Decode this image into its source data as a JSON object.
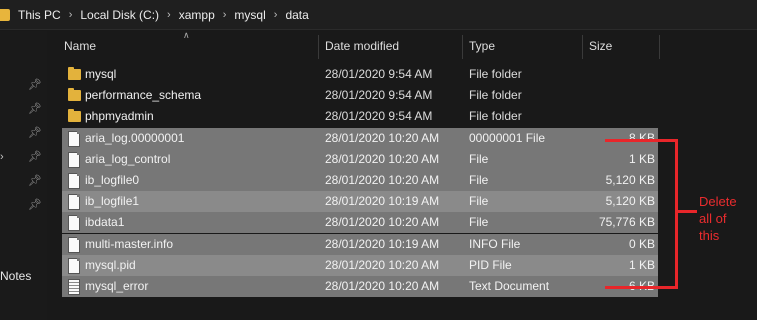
{
  "breadcrumb": {
    "segments": [
      "This PC",
      "Local Disk (C:)",
      "xampp",
      "mysql",
      "data"
    ]
  },
  "sidebar": {
    "partial_label": "Notes"
  },
  "columns": {
    "name": "Name",
    "date": "Date modified",
    "type": "Type",
    "size": "Size"
  },
  "files": [
    {
      "name": "mysql",
      "date": "28/01/2020 9:54 AM",
      "type": "File folder",
      "size": "",
      "icon": "folder-icon",
      "selected": false
    },
    {
      "name": "performance_schema",
      "date": "28/01/2020 9:54 AM",
      "type": "File folder",
      "size": "",
      "icon": "folder-icon",
      "selected": false
    },
    {
      "name": "phpmyadmin",
      "date": "28/01/2020 9:54 AM",
      "type": "File folder",
      "size": "",
      "icon": "folder-icon",
      "selected": false
    },
    {
      "name": "aria_log.00000001",
      "date": "28/01/2020 10:20 AM",
      "type": "00000001 File",
      "size": "8 KB",
      "icon": "file-icon",
      "selected": true
    },
    {
      "name": "aria_log_control",
      "date": "28/01/2020 10:20 AM",
      "type": "File",
      "size": "1 KB",
      "icon": "file-icon",
      "selected": true
    },
    {
      "name": "ib_logfile0",
      "date": "28/01/2020 10:20 AM",
      "type": "File",
      "size": "5,120 KB",
      "icon": "file-icon",
      "selected": true
    },
    {
      "name": "ib_logfile1",
      "date": "28/01/2020 10:19 AM",
      "type": "File",
      "size": "5,120 KB",
      "icon": "file-icon",
      "selected": true
    },
    {
      "name": "ibdata1",
      "date": "28/01/2020 10:20 AM",
      "type": "File",
      "size": "75,776 KB",
      "icon": "file-icon",
      "selected": true
    },
    {
      "name": "multi-master.info",
      "date": "28/01/2020 10:19 AM",
      "type": "INFO File",
      "size": "0 KB",
      "icon": "file-icon",
      "selected": true
    },
    {
      "name": "mysql.pid",
      "date": "28/01/2020 10:20 AM",
      "type": "PID File",
      "size": "1 KB",
      "icon": "file-icon",
      "selected": true
    },
    {
      "name": "mysql_error",
      "date": "28/01/2020 10:20 AM",
      "type": "Text Document",
      "size": "6 KB",
      "icon": "text-document-icon",
      "selected": true
    }
  ],
  "annotation": {
    "text": "Delete all of this",
    "color": "#e8262a"
  },
  "colors": {
    "background": "#191919",
    "selection": "#777777",
    "folder": "#e3b23c"
  }
}
